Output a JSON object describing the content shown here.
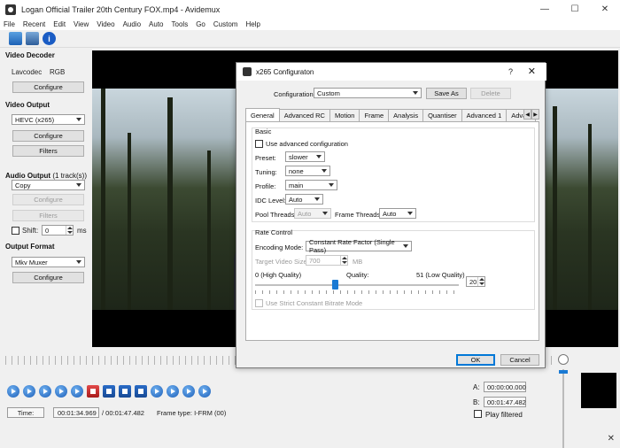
{
  "window": {
    "title": "Logan   Official Trailer   20th Century FOX.mp4 - Avidemux",
    "min": "—",
    "max": "☐",
    "close": "✕"
  },
  "menu": [
    "File",
    "Recent",
    "Edit",
    "View",
    "Video",
    "Audio",
    "Auto",
    "Tools",
    "Go",
    "Custom",
    "Help"
  ],
  "toolbar": {
    "info": "i"
  },
  "left": {
    "video_decoder": {
      "title": "Video Decoder",
      "codec": "Lavcodec",
      "format": "RGB",
      "configure": "Configure"
    },
    "video_output": {
      "title": "Video Output",
      "selected": "HEVC (x265)",
      "configure": "Configure",
      "filters": "Filters"
    },
    "audio_output": {
      "title": "Audio Output",
      "tracks": "(1 track(s))",
      "selected": "Copy",
      "configure": "Configure",
      "filters": "Filters",
      "shift_label": "Shift:",
      "shift_value": "0",
      "shift_unit": "ms"
    },
    "output_format": {
      "title": "Output Format",
      "selected": "Mkv Muxer",
      "configure": "Configure"
    }
  },
  "status": {
    "time_label": "Time:",
    "current_time": "00:01:34.969",
    "total_time": "/ 00:01:47.482",
    "frame_type": "Frame type:  I-FRM (00)"
  },
  "ab": {
    "a_label": "A:",
    "a_value": "00:00:00.000",
    "b_label": "B:",
    "b_value": "00:01:47.482",
    "play_filtered": "Play filtered"
  },
  "bottom_close": "✕",
  "dialog": {
    "title": "x265 Configuraton",
    "help": "?",
    "close": "✕",
    "configuration_label": "Configuration:",
    "configuration_value": "Custom",
    "save_as": "Save As",
    "delete": "Delete",
    "tabs": [
      "General",
      "Advanced RC",
      "Motion",
      "Frame",
      "Analysis",
      "Quantiser",
      "Advanced 1",
      "Advan"
    ],
    "basic": {
      "title": "Basic",
      "use_advanced": "Use advanced configuration",
      "preset_label": "Preset:",
      "preset_value": "slower",
      "tuning_label": "Tuning:",
      "tuning_value": "none",
      "profile_label": "Profile:",
      "profile_value": "main",
      "idc_label": "IDC Level:",
      "idc_value": "Auto",
      "pool_label": "Pool Threads",
      "pool_value": "Auto",
      "frame_threads_label": "Frame Threads",
      "frame_threads_value": "Auto"
    },
    "rate": {
      "title": "Rate Control",
      "mode_label": "Encoding Mode:",
      "mode_value": "Constant Rate Factor (Single Pass)",
      "target_label": "Target Video Size:",
      "target_value": "700",
      "target_unit": "MB",
      "high_label": "0 (High Quality)",
      "quality_label": "Quality:",
      "low_label": "51 (Low Quality)",
      "quality_value": "20",
      "quality_level": 20,
      "quality_max": 51,
      "strict_cbr": "Use Strict Constant Bitrate Mode"
    },
    "ok": "OK",
    "cancel": "Cancel"
  }
}
